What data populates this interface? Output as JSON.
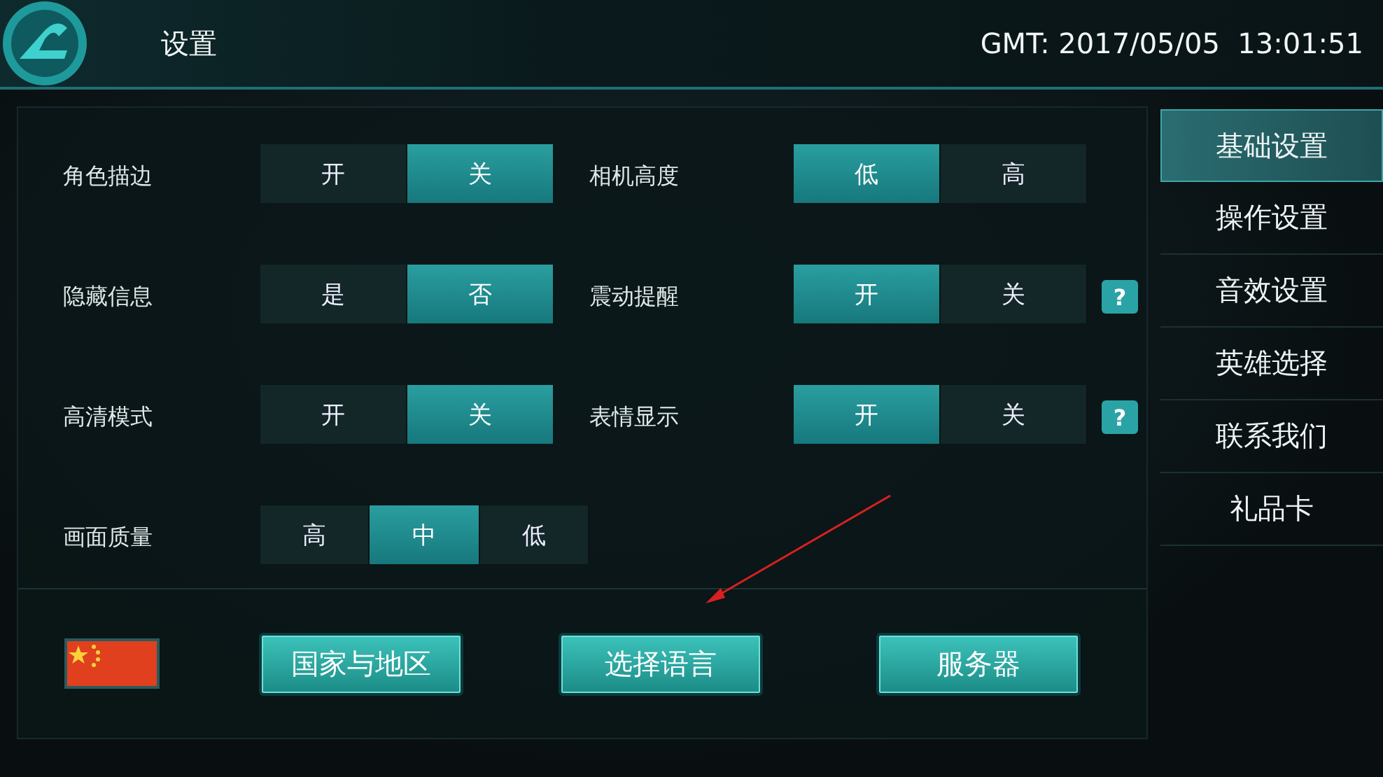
{
  "header": {
    "title": "设置",
    "clock": "GMT: 2017/05/05  13:01:51"
  },
  "settings": [
    {
      "label": "角色描边",
      "options": [
        {
          "label": "开",
          "selected": false
        },
        {
          "label": "关",
          "selected": true
        }
      ]
    },
    {
      "label": "相机高度",
      "options": [
        {
          "label": "低",
          "selected": true
        },
        {
          "label": "高",
          "selected": false
        }
      ]
    },
    {
      "label": "隐藏信息",
      "options": [
        {
          "label": "是",
          "selected": false
        },
        {
          "label": "否",
          "selected": true
        }
      ]
    },
    {
      "label": "震动提醒",
      "help_label": "?",
      "options": [
        {
          "label": "开",
          "selected": true
        },
        {
          "label": "关",
          "selected": false
        }
      ]
    },
    {
      "label": "高清模式",
      "options": [
        {
          "label": "开",
          "selected": false
        },
        {
          "label": "关",
          "selected": true
        }
      ]
    },
    {
      "label": "表情显示",
      "help_label": "?",
      "options": [
        {
          "label": "开",
          "selected": true
        },
        {
          "label": "关",
          "selected": false
        }
      ]
    },
    {
      "label": "画面质量",
      "options": [
        {
          "label": "高",
          "selected": false
        },
        {
          "label": "中",
          "selected": true
        },
        {
          "label": "低",
          "selected": false
        }
      ]
    }
  ],
  "footer": {
    "buttons": [
      "国家与地区",
      "选择语言",
      "服务器"
    ]
  },
  "sidebar": {
    "items": [
      {
        "label": "基础设置",
        "selected": true
      },
      {
        "label": "操作设置",
        "selected": false
      },
      {
        "label": "音效设置",
        "selected": false
      },
      {
        "label": "英雄选择",
        "selected": false
      },
      {
        "label": "联系我们",
        "selected": false
      },
      {
        "label": "礼品卡",
        "selected": false
      }
    ]
  }
}
